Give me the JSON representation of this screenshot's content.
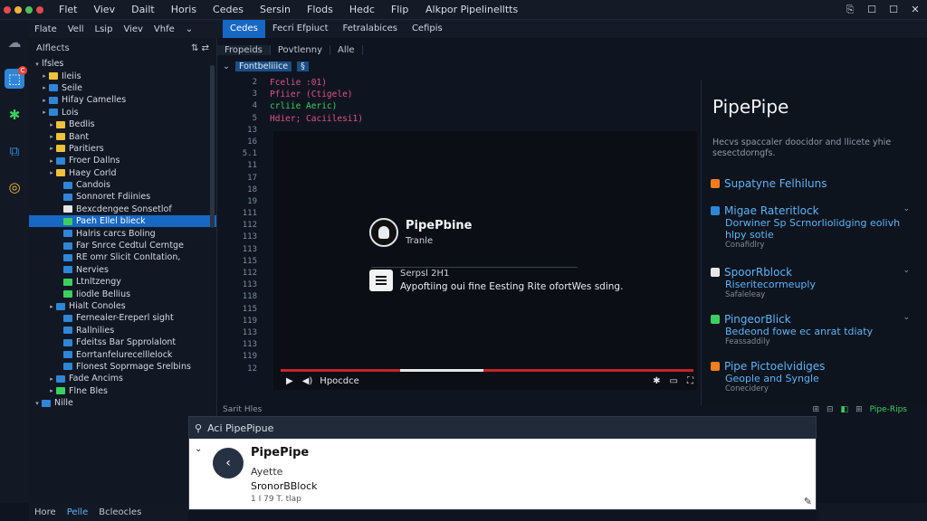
{
  "window": {
    "title": "Alkpor Pipelinelltts",
    "menus": [
      "Flet",
      "Viev",
      "Dailt",
      "Horis",
      "Cedes",
      "Sersin",
      "Flods",
      "Hedc",
      "Flip"
    ],
    "controls": [
      "⎘",
      "☐",
      "☐",
      "✕"
    ]
  },
  "activity_bar": {
    "icons": [
      "☁",
      "⬚",
      "✱",
      "⧉",
      "◎"
    ],
    "badge": "C"
  },
  "menu2": [
    "Flate",
    "Vell",
    "Lsip",
    "Viev",
    "Vhfe",
    "⌄"
  ],
  "explorer": {
    "title": "Alflects",
    "actions": "⇅ ⇄",
    "items": [
      {
        "label": "lfsles",
        "chev": "▾",
        "indent": 0,
        "color": ""
      },
      {
        "label": "Ileiis",
        "chev": "▸",
        "indent": 1,
        "color": "#f0c13a"
      },
      {
        "label": "Seile",
        "chev": "▸",
        "indent": 1,
        "color": "#2f86d6"
      },
      {
        "label": "Hifay Camelles",
        "chev": "▸",
        "indent": 1,
        "color": "#2f86d6"
      },
      {
        "label": "Lois",
        "chev": "▸",
        "indent": 1,
        "color": "#2f86d6"
      },
      {
        "label": "Bedlis",
        "chev": "▸",
        "indent": 2,
        "color": "#f0c13a"
      },
      {
        "label": "Bant",
        "chev": "▸",
        "indent": 2,
        "color": "#f0c13a"
      },
      {
        "label": "Paritiers",
        "chev": "▸",
        "indent": 2,
        "color": "#f0c13a"
      },
      {
        "label": "Froer Dallns",
        "chev": "▸",
        "indent": 2,
        "color": "#2f86d6"
      },
      {
        "label": "Haey Corld",
        "chev": "▸",
        "indent": 2,
        "color": "#f0c13a"
      },
      {
        "label": "Candois",
        "chev": "",
        "indent": 3,
        "color": "#2f86d6"
      },
      {
        "label": "Sonnoret Fdiinies",
        "chev": "",
        "indent": 3,
        "color": "#2f86d6"
      },
      {
        "label": "Bexcdengee Sonsetlof",
        "chev": "",
        "indent": 3,
        "color": "#e6e6e6"
      },
      {
        "label": "Paeh Ellel blieck",
        "chev": "",
        "indent": 3,
        "color": "#3ccf5f",
        "selected": true
      },
      {
        "label": "Halris carcs Boling",
        "chev": "",
        "indent": 3,
        "color": "#2f86d6"
      },
      {
        "label": "Far Snrce Cedtul Cerntge",
        "chev": "",
        "indent": 3,
        "color": "#2f86d6"
      },
      {
        "label": "RE omr Slicit Conltation,",
        "chev": "",
        "indent": 3,
        "color": "#2f86d6"
      },
      {
        "label": "Nervies",
        "chev": "",
        "indent": 3,
        "color": "#2f86d6"
      },
      {
        "label": "Ltnltzengy",
        "chev": "",
        "indent": 3,
        "color": "#3ccf5f"
      },
      {
        "label": "Iiodle Bellius",
        "chev": "",
        "indent": 3,
        "color": "#3ccf5f"
      },
      {
        "label": "Hialt Conoles",
        "chev": "▸",
        "indent": 2,
        "color": "#2f86d6"
      },
      {
        "label": "Fernealer-Ereperl sight",
        "chev": "",
        "indent": 3,
        "color": "#2f86d6"
      },
      {
        "label": "Rallnilies",
        "chev": "",
        "indent": 3,
        "color": "#2f86d6"
      },
      {
        "label": "Fdeitss Bar Spprolalont",
        "chev": "",
        "indent": 3,
        "color": "#2f86d6"
      },
      {
        "label": "Eorrtanfelurecelllelock",
        "chev": "",
        "indent": 3,
        "color": "#2f86d6"
      },
      {
        "label": "Flonest Soprmage Srelbins",
        "chev": "",
        "indent": 3,
        "color": "#2f86d6"
      },
      {
        "label": "Fade Ancims",
        "chev": "▸",
        "indent": 2,
        "color": "#2f86d6"
      },
      {
        "label": "Flne Bles",
        "chev": "▸",
        "indent": 2,
        "color": "#3ccf5f"
      },
      {
        "label": "Nille",
        "chev": "▾",
        "indent": 0,
        "color": "#2f86d6"
      }
    ]
  },
  "tabs": [
    "Cedes",
    "Fecri Efpiuct",
    "Fetralabices",
    "Cefipis"
  ],
  "subtabs": [
    "Fropeids",
    "Povtlenny",
    "Alle"
  ],
  "breadcrumb": {
    "chev": "⌄",
    "label": "Fontbeliiice",
    "mark": "§"
  },
  "gutter": [
    "2",
    "3",
    "4",
    "5",
    "13",
    "16",
    "5.1",
    "11",
    "17",
    "18",
    "19",
    "111",
    "112",
    "113",
    "113",
    "115",
    "112",
    "113",
    "118",
    "115",
    "119",
    "113",
    "113",
    "119",
    "12"
  ],
  "code": [
    {
      "text": "Fcelie :01)",
      "color": "#e0508a"
    },
    {
      "text": "Pfiier (Ctigele)",
      "color": "#e0508a"
    },
    {
      "text": "crliie Aeric)",
      "color": "#3ccf5f"
    },
    {
      "text": "Hdier; Caciilesi1)",
      "color": "#e0508a"
    }
  ],
  "video": {
    "title": "PipePbine",
    "subtitle": "Tranle",
    "item_title": "Serpsl 2H1",
    "item_desc": "Aypoftiing oui fine Eesting Rite ofortWes sding.",
    "time": "Hpocdce",
    "progress": 0.29
  },
  "right_panel": {
    "title": "PipePipe",
    "description": "Hecvs spaccaler doocidor and llicete yhie sesectdorngfs.",
    "items": [
      {
        "title": "Supatyne Felhiluns",
        "line": "",
        "meta": "",
        "color": "#f07d1f",
        "chev": ""
      },
      {
        "title": "Migae Rateritlock",
        "line": "Dorwiner Sp Scrnorliolidging eolivh hlpy sotie",
        "meta": "Conafidlry",
        "color": "#2f86d6",
        "chev": "⌄"
      },
      {
        "title": "SpoorRblock",
        "line": "Riseritecormeuply",
        "meta": "Safaleleay",
        "color": "#e6e6e6",
        "chev": "⌄"
      },
      {
        "title": "PingeorBlick",
        "line": "Bedeond fowe ec anrat tdiaty",
        "meta": "Feassaddily",
        "color": "#3ccf5f",
        "chev": "⌄"
      },
      {
        "title": "Pipe Pictoelvidiges",
        "line": "Geople and Syngle",
        "meta": "Conecidery",
        "color": "#f07d1f",
        "chev": ""
      }
    ]
  },
  "panel_bar": {
    "title": "Sarit Hles",
    "right": [
      "⊞",
      "⊟",
      "◧",
      "⊞",
      "Pipe-Rips"
    ]
  },
  "popup": {
    "header": "Aci PipePipue",
    "title": "PipePipe",
    "subtitle": "Ayette",
    "line": "SronorBBlock",
    "meta": "1 I 79 T. tlap",
    "back_icon": "‹",
    "edit_icon": "✎"
  },
  "status": [
    "Hore",
    "Pelle",
    "Bcleocles"
  ]
}
